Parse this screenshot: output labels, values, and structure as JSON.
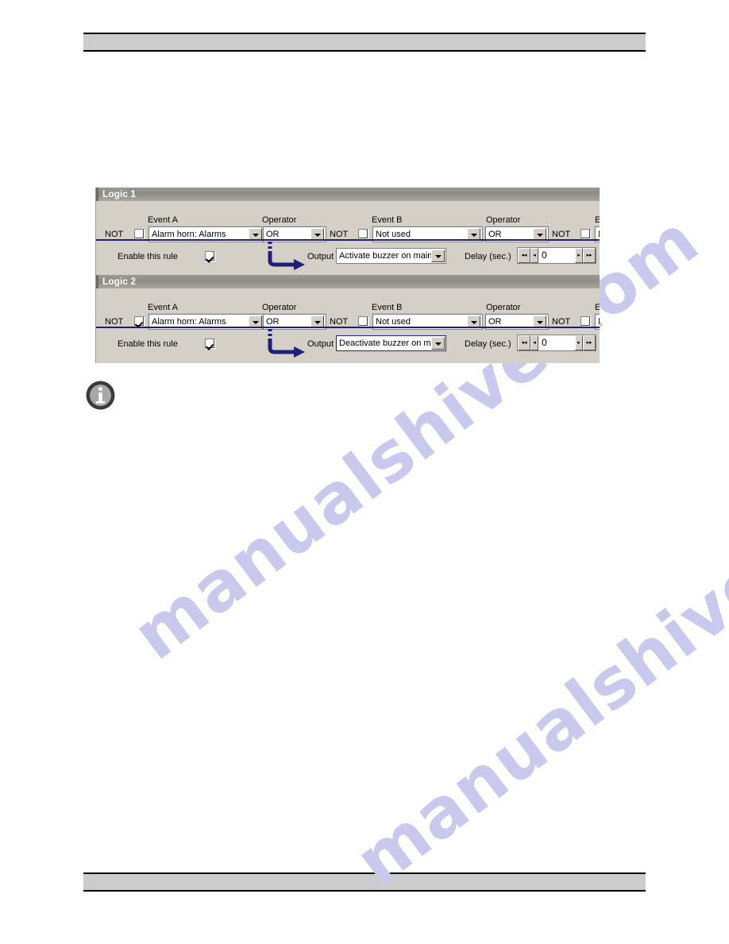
{
  "page": {
    "watermark_text": "manualshive.com",
    "header_bar": "",
    "footer_bar": ""
  },
  "colors": {
    "dialog_background": "#d4d0c8",
    "group_title_background": "#8d8d86",
    "group_title_text": "#ffffff",
    "separator_blue": "#1f1f7a",
    "arrow_blue": "#1f1f7a",
    "focus_border": "#20208a",
    "page_rule_fill": "#cccccc",
    "watermark": "#c9c9ee",
    "info_icon_fill": "#3a3a3a"
  },
  "dialog": {
    "column_headers": {
      "event_a": "Event A",
      "operator_1": "Operator",
      "event_b": "Event B",
      "operator_2": "Operator",
      "event_c": "E"
    },
    "not_label": "NOT",
    "enable_label": "Enable this rule",
    "output_label": "Output",
    "delay_label": "Delay (sec.)",
    "spinner_buttons": {
      "first": "◂◂",
      "prev": "◂",
      "next": "▸",
      "last": "▸▸"
    },
    "groups": [
      {
        "title": "Logic 1",
        "not_a_checked": false,
        "event_a": "Alarm horn: Alarms",
        "operator_1": "OR",
        "not_b_checked": false,
        "event_b": "Not used",
        "operator_2": "OR",
        "not_c_checked": false,
        "event_c": "N",
        "enabled": true,
        "output": "Activate buzzer on main u",
        "output_focused": false,
        "delay": "0"
      },
      {
        "title": "Logic 2",
        "not_a_checked": true,
        "event_a": "Alarm horn: Alarms",
        "operator_1": "OR",
        "not_b_checked": false,
        "event_b": "Not used",
        "operator_2": "OR",
        "not_c_checked": false,
        "event_c": "N",
        "enabled": true,
        "output": "Deactivate buzzer on mai",
        "output_focused": true,
        "delay": "0"
      }
    ]
  }
}
